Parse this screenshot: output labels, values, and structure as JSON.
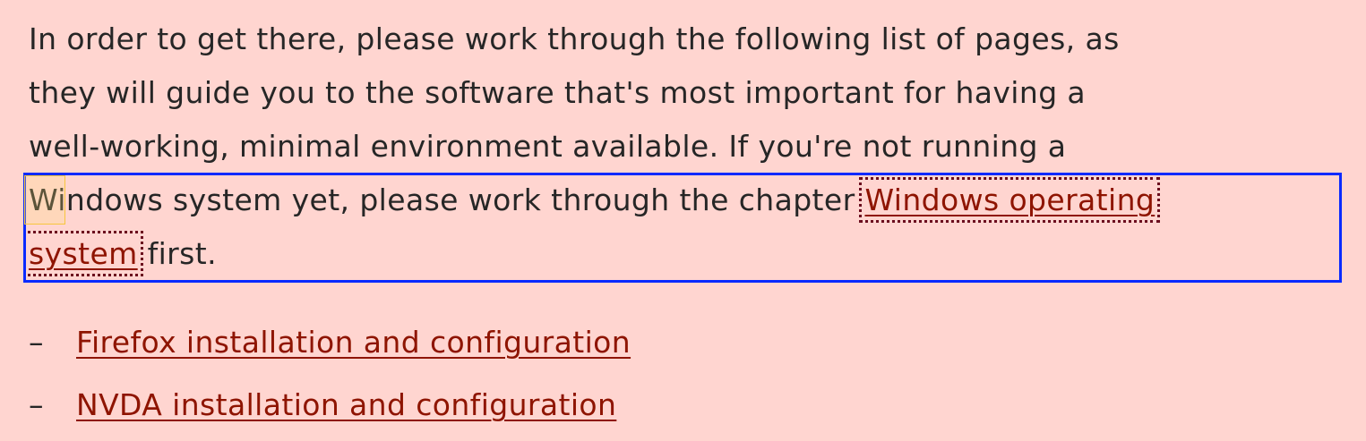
{
  "paragraph": {
    "line1": "In order to get there, please work through the following list of pages, as",
    "line2": "they will guide you to the software that's most important for having a",
    "line3": "well-working, minimal environment available. If you're not running a",
    "line4_text": "Windows system yet, please work through the chapter ",
    "link_part1": "Windows operating",
    "link_part2": "system",
    "line5_rest": " first."
  },
  "list": {
    "marker": "–",
    "items": [
      "Firefox installation and configuration",
      "NVDA installation and configuration"
    ]
  },
  "colors": {
    "background": "#ffd5d0",
    "text": "#262626",
    "link": "#8e1400",
    "focus_box": "#0a2aff",
    "caret_highlight": "#f7c63d"
  }
}
